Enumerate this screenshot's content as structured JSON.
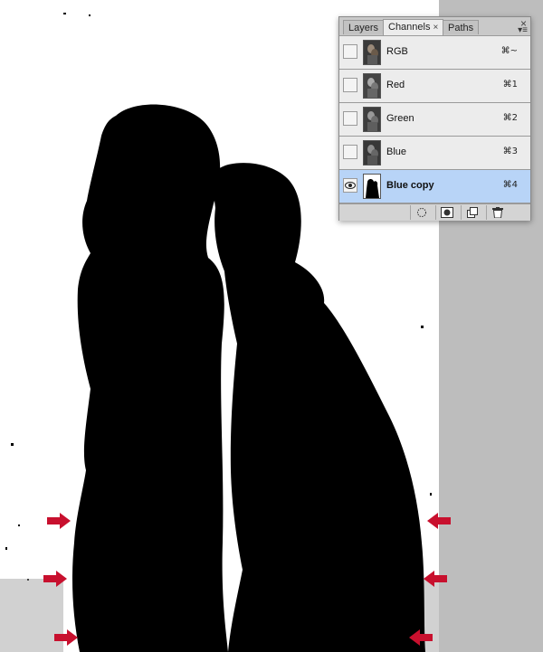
{
  "panel": {
    "tabs": [
      {
        "label": "Layers",
        "active": false
      },
      {
        "label": "Channels",
        "active": true
      },
      {
        "label": "Paths",
        "active": false
      }
    ],
    "close_glyph": "×",
    "tab_close_glyph": "×",
    "menu_glyph": "▾≡",
    "channels": [
      {
        "name": "RGB",
        "shortcut": "⌘~",
        "visible": false,
        "selected": false
      },
      {
        "name": "Red",
        "shortcut": "⌘1",
        "visible": false,
        "selected": false
      },
      {
        "name": "Green",
        "shortcut": "⌘2",
        "visible": false,
        "selected": false
      },
      {
        "name": "Blue",
        "shortcut": "⌘3",
        "visible": false,
        "selected": false
      },
      {
        "name": "Blue copy",
        "shortcut": "⌘4",
        "visible": true,
        "selected": true
      }
    ],
    "footer_buttons": [
      "load-selection-icon",
      "save-selection-icon",
      "new-channel-icon",
      "trash-icon"
    ]
  },
  "colors": {
    "selected_row": "#b8d4f7",
    "arrow": "#c8102e",
    "gray_background": "#bdbdbd"
  }
}
